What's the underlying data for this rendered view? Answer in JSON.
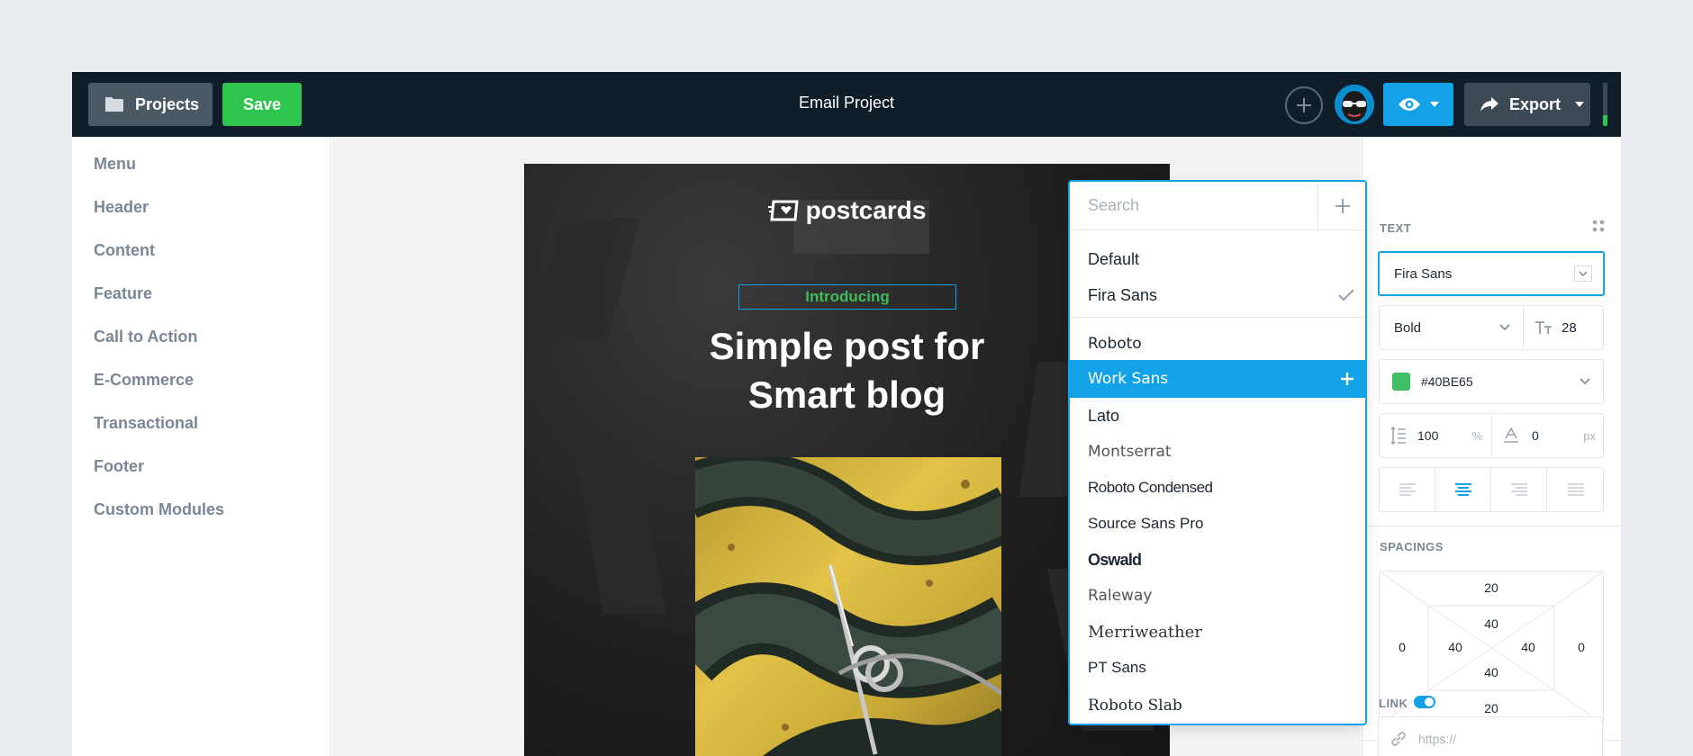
{
  "topbar": {
    "projects_label": "Projects",
    "save_label": "Save",
    "title": "Email Project",
    "export_label": "Export",
    "status_progress": 0.25
  },
  "sidebar": {
    "items": [
      "Menu",
      "Header",
      "Content",
      "Feature",
      "Call to Action",
      "E-Commerce",
      "Transactional",
      "Footer",
      "Custom Modules"
    ]
  },
  "email": {
    "logo_text": "postcards",
    "introducing": "Introducing",
    "headline_line1": "Simple post for",
    "headline_line2": "Smart blog"
  },
  "font_dropdown": {
    "search_placeholder": "Search",
    "fonts": [
      "Default",
      "Fira Sans",
      "Roboto",
      "Work Sans",
      "Lato",
      "Montserrat",
      "Roboto Condensed",
      "Source Sans Pro",
      "Oswald",
      "Raleway",
      "Merriweather",
      "PT Sans",
      "Roboto Slab"
    ],
    "checked": "Fira Sans",
    "highlighted": "Work Sans"
  },
  "panel": {
    "text_section": "TEXT",
    "font_family": "Fira Sans",
    "font_weight": "Bold",
    "font_size": "28",
    "color": "#40BE65",
    "line_height": "100",
    "line_height_unit": "%",
    "letter_spacing": "0",
    "letter_spacing_unit": "px",
    "spacings_section": "SPACINGS",
    "margin": {
      "top": "20",
      "right": "0",
      "bottom": "20",
      "left": "0"
    },
    "padding": {
      "top": "40",
      "right": "40",
      "bottom": "40",
      "left": "40"
    },
    "link_section": "LINK",
    "link_placeholder": "https://"
  },
  "colors": {
    "accent": "#13a2e8",
    "save_green": "#2dc54e",
    "topbar": "#0f1e29",
    "text_color_swatch": "#40BE65"
  }
}
